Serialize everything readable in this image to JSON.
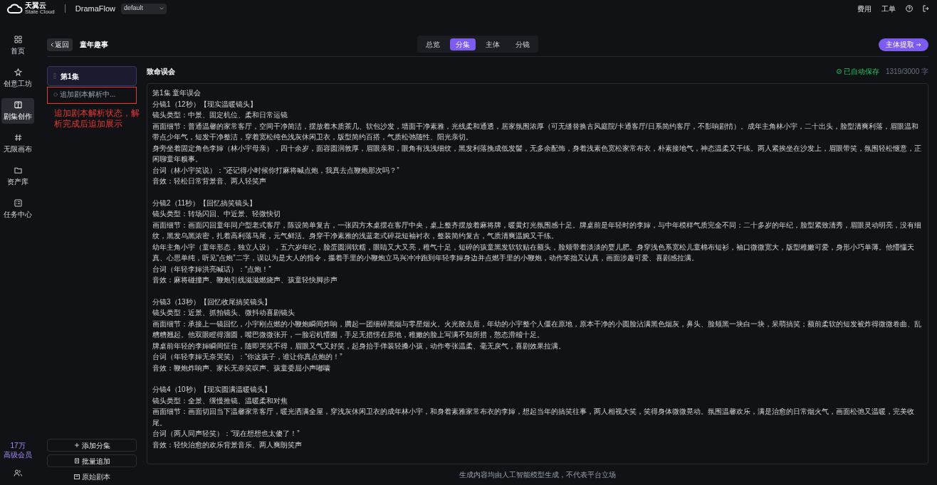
{
  "top_bar": {
    "logo_text": "天翼云",
    "logo_subtext": "State Cloud",
    "app_name": "DramaFlow",
    "workspace": "default",
    "links": [
      "费用",
      "工单"
    ]
  },
  "nav": [
    {
      "label": "首页",
      "selected": false
    },
    {
      "label": "创意工坊",
      "selected": false
    },
    {
      "label": "剧集创作",
      "selected": true
    },
    {
      "label": "无限画布",
      "selected": false
    },
    {
      "label": "资产库",
      "selected": false
    },
    {
      "label": "任务中心",
      "selected": false
    }
  ],
  "membership": {
    "points": "17万",
    "tier": "高级会员"
  },
  "header": {
    "back": "返回",
    "title": "童年趣事",
    "action": "主体提取",
    "tabs": [
      {
        "label": "总览",
        "selected": false
      },
      {
        "label": "分集",
        "selected": true
      },
      {
        "label": "主体",
        "selected": false
      },
      {
        "label": "分镜",
        "selected": false
      }
    ]
  },
  "episodes": [
    {
      "label": "第1集",
      "selected": true
    }
  ],
  "parse_status": "追加剧本解析中...",
  "annotation": "追加剧本解析状态，解析完成后追加展示",
  "episode_actions": [
    "添加分集",
    "批量追加"
  ],
  "raw_script_link": "原始剧本",
  "editor": {
    "title": "致命误会",
    "save_status": "已自动保存",
    "word_count": "1319/3000 字",
    "blocks": [
      [
        "第1集 童年误会",
        "分镜1（12秒）【现实温暖镜头】",
        "镜头类型：中景、固定机位、柔和日常运镜",
        "画面细节：普通温馨的家常客厅，空间干净简洁，摆放着木质茶几、软包沙发，墙面干净素雅，光线柔和通透，居家氛围浓厚（可无缝替换古风庭院/卡通客厅/日系简约客厅，不影响剧情）。成年主角林小宇，二十出头，脸型清爽利落，眉眼温和带点少年气，短发干净整洁，穿着宽松纯色浅灰休闲卫衣，版型简约百搭，气质松弛随性、阳光亲切。",
        "身旁坐着固定角色李婶（林小宇母亲），四十余岁，面容圆润敦厚，眉眼亲和，眼角有浅浅细纹，黑发利落挽成低发髻，无多余配饰，身着浅素色宽松家常布衣，朴素接地气，神态温柔又干练。两人紧挨坐在沙发上，眉眼带笑，氛围轻松惬意，正闲聊童年糗事。",
        "台词（林小宇笑说）：“还记得小时候你打麻将喊点炮，我真去点鞭炮那次吗？”",
        "音效：轻松日常背景音、两人轻笑声"
      ],
      [
        "分镜2（11秒）【回忆搞笑镜头】",
        "镜头类型：转场闪回、中近景、轻微快切",
        "画面细节：画面闪回童年同户型老式客厅，陈设简单复古，一张四方木桌摆在客厅中央，桌上整齐摆放着麻将牌，暖黄灯光氛围感十足。牌桌前是年轻时的李婶，与中年模样气质完全不同：二十多岁的年纪，脸型紧致清秀，眉眼灵动明亮，没有细纹，黑发乌黑浓密，扎着高利落马尾，元气鲜活。身穿干净素雅的浅蓝老式碎花短袖衬衣，整装简约复古，气质清爽温婉又干练。",
        "幼年主角小宇（童年形态，独立人设），五六岁年纪，脸蛋圆润软糯，眼睛又大又亮，稚气十足，短碎的孩童黑发软软贴在额头，脸颊带着淡淡的婴儿肥。身穿浅色系宽松儿童棉布短衫，袖口微微宽大，版型稚嫩可爱，身形小巧单薄。他懵懂天真、心思单纯，听见“点炮”二字，误以为是大人的指令，攥着手里的小鞭炮立马兴冲冲跑到年轻李婶身边并点燃手里的小鞭炮，动作笨拙又认真，画面涉趣可爱、喜剧感拉满。",
        "台词（年轻李婶洪亮喊话）：“点炮！”",
        "音效：麻将碰撞声、鞭炮引线滋滋燃烧声、孩童轻快脚步声"
      ],
      [
        "分镜3（13秒）【回忆收尾搞笑镜头】",
        "镜头类型：近景、抓拍镜头、微抖动喜剧镜头",
        "画面细节：承接上一镜回忆，小宇刚点燃的小鞭炮瞬间炸响，腾起一团细碎黑烟与零星烟火。火光散去后，年幼的小宇整个人僵在原地，原本干净的小圆脸沾满黑色烟灰，鼻头、脸颊黑一块白一块，呆萌搞笑；额前柔软的短发被炸得微微卷曲、乱糟糟翘起。他双眼瞪得溜圆，嘴巴微微张开，一脸宕机懵圈，手足无措愣在原地，稚嫩的脸上写满不知所措，憨态滑稽十足。",
        "牌桌前年轻的李婶瞬间怔住，随即哭笑不得，眉眼又气又好笑，起身抬手佯装轻搡小孩，动作夸张温柔、毫无戾气，喜剧效果拉满。",
        "台词（年轻李婶无奈哭笑）：“你这孩子，谁让你真点炮的！”",
        "音效：鞭炮炸响声、家长无奈笑叹声、孩童委屈小声嘟囔"
      ],
      [
        "分镜4（10秒）【现实圆满温暖镜头】",
        "镜头类型：全景、缓慢推镜、温暖柔和对焦",
        "画面细节：画面切回当下温馨家常客厅，暖光洒满全屋，穿浅灰休闲卫衣的成年林小宇，和身着素雅家常布衣的李婶，想起当年的搞笑往事，两人相视大笑，笑得身体微微晃动。氛围温馨欢乐，满是治愈的日常烟火气，画面松弛又温暖，完美收尾。",
        "台词（两人同声轻笑）：“现在想想也太傻了！”",
        "音效：轻快治愈的欢乐背景音乐、两人爽朗笑声"
      ]
    ]
  },
  "footer": "生成内容均由人工智能模型生成，不代表平台立场"
}
